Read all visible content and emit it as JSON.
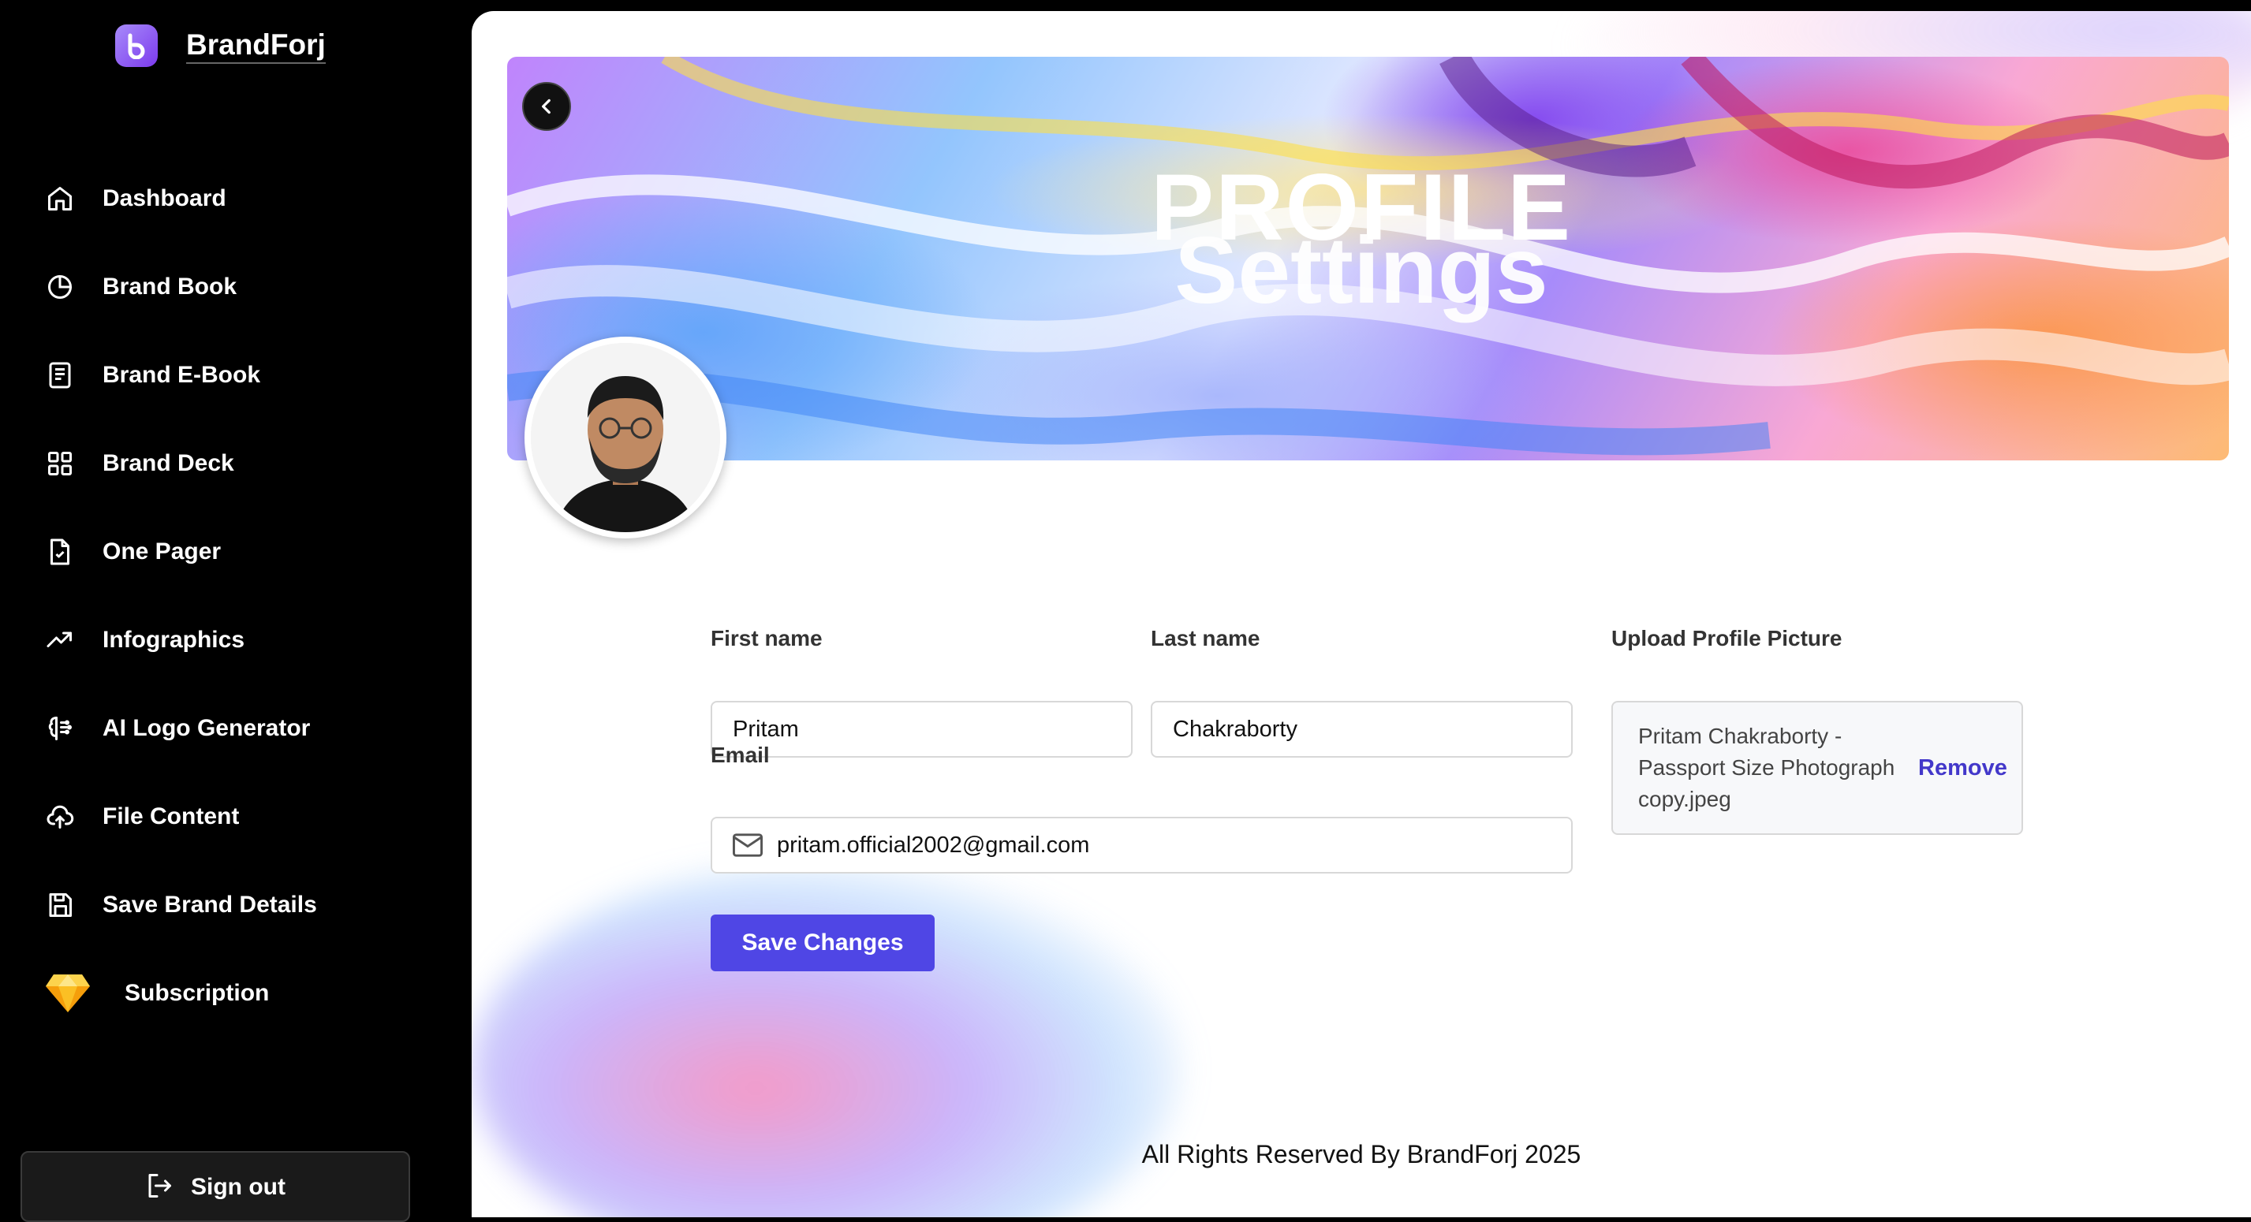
{
  "brand": {
    "name": "BrandForj",
    "accent": "#7c3aed"
  },
  "sidebar": {
    "items": [
      {
        "label": "Dashboard",
        "icon": "home-icon"
      },
      {
        "label": "Brand Book",
        "icon": "pie-chart-icon"
      },
      {
        "label": "Brand E-Book",
        "icon": "document-icon"
      },
      {
        "label": "Brand Deck",
        "icon": "grid-icon"
      },
      {
        "label": "One Pager",
        "icon": "file-check-icon"
      },
      {
        "label": "Infographics",
        "icon": "trending-up-icon"
      },
      {
        "label": "AI Logo Generator",
        "icon": "brain-icon"
      },
      {
        "label": "File Content",
        "icon": "cloud-upload-icon"
      },
      {
        "label": "Save Brand Details",
        "icon": "save-icon"
      },
      {
        "label": "Subscription",
        "icon": "diamond-icon"
      }
    ],
    "signout": "Sign out"
  },
  "banner": {
    "title_line1": "PROFILE",
    "title_line2": "Settings"
  },
  "form": {
    "first_name_label": "First name",
    "first_name_value": "Pritam",
    "last_name_label": "Last name",
    "last_name_value": "Chakraborty",
    "email_label": "Email",
    "email_value": "pritam.official2002@gmail.com",
    "upload_label": "Upload Profile Picture",
    "upload_file": "Pritam Chakraborty - Passport Size Photograph copy.jpeg",
    "remove_label": "Remove",
    "save_label": "Save Changes"
  },
  "footer": {
    "text": "All Rights Reserved By BrandForj 2025"
  },
  "colors": {
    "primary_button": "#4f46e5",
    "link": "#4338ca",
    "sidebar_bg": "#000000"
  }
}
